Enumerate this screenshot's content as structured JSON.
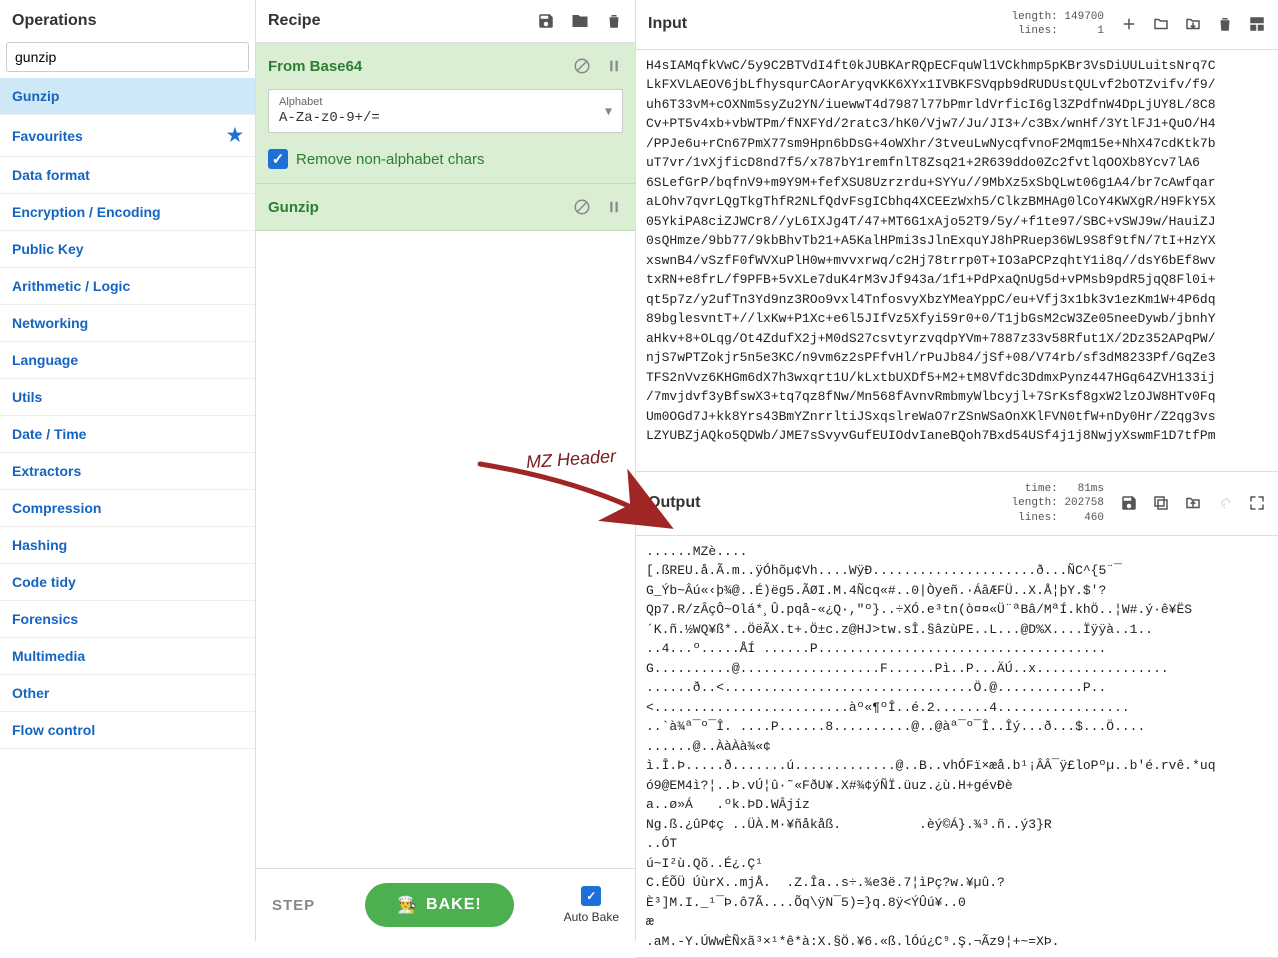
{
  "operations": {
    "title": "Operations",
    "search_value": "gunzip",
    "items": [
      "Gunzip",
      "Favourites",
      "Data format",
      "Encryption / Encoding",
      "Public Key",
      "Arithmetic / Logic",
      "Networking",
      "Language",
      "Utils",
      "Date / Time",
      "Extractors",
      "Compression",
      "Hashing",
      "Code tidy",
      "Forensics",
      "Multimedia",
      "Other",
      "Flow control"
    ],
    "selected": "Gunzip",
    "starred": "Favourites"
  },
  "recipe": {
    "title": "Recipe",
    "blocks": [
      {
        "name": "From Base64",
        "alphabet_label": "Alphabet",
        "alphabet_value": "A-Za-z0-9+/=",
        "checkbox_label": "Remove non-alphabet chars",
        "checked": true
      },
      {
        "name": "Gunzip"
      }
    ],
    "step_label": "STEP",
    "bake_label": "BAKE!",
    "autobake_label": "Auto Bake",
    "autobake_checked": true
  },
  "input": {
    "title": "Input",
    "meta": "length: 149700\n lines:      1",
    "content": "H4sIAMqfkVwC/5y9C2BTVdI4ft0kJUBKArRQpECFquWl1VCkhmp5pKBr3VsDiUULuitsNrq7C\nLkFXVLAEOV6jbLfhysqurCAorAryqvKK6XYx1IVBKFSVqpb9dRUDUstQULvf2bOTZvifv/f9/\nuh6T33vM+cOXNm5syZu2YN/iuewwT4d7987l77bPmrldVrficI6gl3ZPdfnW4DpLjUY8L/8C8\nCv+PT5v4xb+vbWTPm/fNXFYd/2ratc3/hK0/Vjw7/Ju/JI3+/c3Bx/wnHf/3YtlFJ1+QuO/H4\n/PPJe6u+rCn67PmX77sm9Hpn6bDsG+4oWXhr/3tveuLwNycqfvnoF2Mqm15e+NhX47cdKtk7b\nuT7vr/1vXjficD8nd7f5/x787bY1remfnlT8Zsq21+2R639ddo0Zc2fvtlqOOXb8Ycv7lA6\n6SLefGrP/bqfnV9+m9Y9M+fefXSU8Uzrzrdu+SYYu//9MbXz5xSbQLwt06g1A4/br7cAwfqar\naLOhv7qvrLQgTkgThfR2NLfQdvFsgICbhq4XCEEzWxh5/ClkzBMHAg0lCoY4KWXgR/H9FkY5X\n05YkiPA8ciZJWCr8//yL6IXJg4T/47+MT6G1xAjo52T9/5y/+f1te97/SBC+vSWJ9w/HauiZJ\n0sQHmze/9bb77/9kbBhvTb21+A5KalHPmi3sJlnExquYJ8hPRuep36WL9S8f9tfN/7tI+HzYX\nxswnB4/vSzfF0fWVXuPlH0w+mvvxrwq/c2Hj78trrp0T+IO3aPCPzqhtY1i8q//dsY6bEf8wv\ntxRN+e8frL/f9PFB+5vXLe7duK4rM3vJf943a/1f1+PdPxaQnUg5d+vPMsb9pdR5jqQ8Fl0i+\nqt5p7z/y2ufTn3Yd9nz3ROo9vxl4TnfosvyXbzYMeaYppC/eu+Vfj3x1bk3v1ezKm1W+4P6dq\n89bglesvntT+//lxKw+P1Xc+e6l5JIfVz5Xfyi59r0+0/T1jbGsM2cW3Ze05neeDywb/jbnhY\naHkv+8+OLqg/Ot4ZdufX2j+M0dS27csvtyrzvqdpYVm+7887z33v58Rfut1X/2Dz352APqPW/\nnjS7wPTZokjr5n5e3KC/n9vm6z2sPFfvHl/rPuJb84/jSf+08/V74rb/sf3dM8233Pf/GqZe3\nTFS2nVvz6KHGm6dX7h3wxqrt1U/kLxtbUXDf5+M2+tM8Vfdc3DdmxPynz447HGq64ZVH133ij\n/7mvjdvf3yBfswX3+tq7qz8fNw/Mn568fAvnvRmbmyWlbcyjl+7SrKsf8gxW2lzOJW8HTv0Fq\nUm0OGd7J+kk8Yrs43BmYZnrrltiJSxqslreWaO7rZSnWSaOnXKlFVN0tfW+nDy0Hr/Z2qg3vs\nLZYUBZjAQko5QDWb/JME7sSvyvGufEUIOdvIaneBQoh7Bxd54USf4j1j8NwjyXswmF1D7tfPm"
  },
  "output": {
    "title": "Output",
    "meta": "  time:   81ms\nlength: 202758\n lines:    460",
    "content": "......MZè....\n[.ßREU.å.Ã.m..ÿÓhõµ¢Vh....WÿÐ.....................ð...ÑC^{5¨¯\nG_Ýb~Âú«‹þ¾@..É)ëg5.ÃØI.M.4Ñcq«#..0|Òyeñ.·ÁâÆFÜ..X.Å¦þY.$'?\nQp7.R/zÂçÔ~Olá*¸Û.pqå-«¿Q·,\"º}..÷XÓ.e³tn(ò¤¤«Ü¨ªBâ/MªÍ.khÖ..¦W#.ý·ê¥ËS\n´K.ñ.½WQ¥ß*..ÖëÃX.t+.Ö±c.z@HJ>tw.sÎ.§âzùPE..L...@D%X....Ïÿÿà..1..\n..4...º.....ÅÍ ......P.....................................\nG..........@..................F......Pì..P...ÄÚ..x.................\n......ð..<................................Ö.@...........P..\n<.........................àº«¶ºÎ..é.2.......4.................\n..`à¾ª¯º¯Î. ....P......8..........@..@àª¯º¯Î..Îý...ð...$...Ö....\n......@..ÀàÀà¾«¢\nì.Î.Þ.....ð.......ú.............@..B..vhÓFï×æå.b¹¡ÂÂ¯ÿ£loPºµ..b'é.rvê.*uq\nó9@EM4ì?¦..Þ.vÚ¦û·˜«FðU¥.X#¾¢ýÑÏ.üuz.¿ù.H+gévÐè\na..ø»Á   .ºk.ÞD.WÂjíz\nNg.ß.¿ûP¢ç ..ÜÀ.M·¥ñåkåß.          .èý©Á}.¾³.ñ..ý3}R\n..ÓT\nú~I²ù.Qõ..É¿.Ç¹\nC.ÉÕÜ ÚùrX..mjÅ.  .Z.Îa..s÷.¾e3ë.7¦ìPç?w.¥µû.?\nÈ³]M.I._¹¯Þ.ô7Ã....Õq\\ÿN¯5)=}q.8ÿ<ÝÛú¥..0\næ\n.aM.-Y.ÚWwÈÑxã³×¹*ê*à:X.§Ö.¥6.«ß.lÓú¿C⁹.Ş.¬Ãz9¦+~=XÞ."
  },
  "annotation": {
    "text": "MZ Header"
  }
}
